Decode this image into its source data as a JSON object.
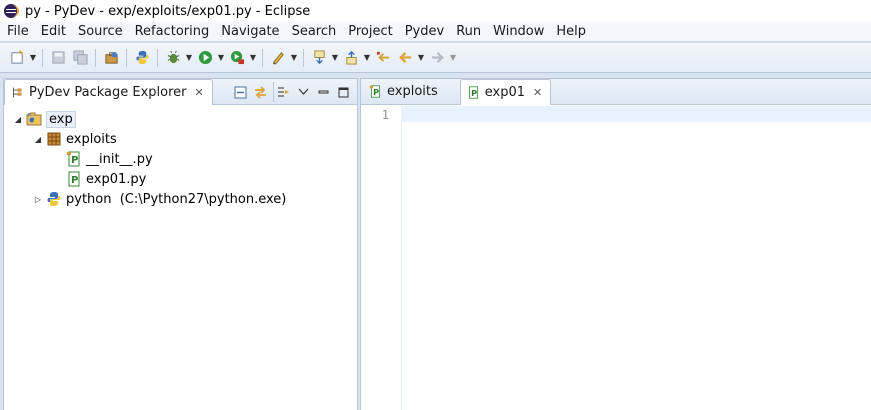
{
  "window": {
    "title": "py - PyDev - exp/exploits/exp01.py - Eclipse"
  },
  "menu": [
    "File",
    "Edit",
    "Source",
    "Refactoring",
    "Navigate",
    "Search",
    "Project",
    "Pydev",
    "Run",
    "Window",
    "Help"
  ],
  "explorer": {
    "tab_label": "PyDev Package Explorer",
    "tree": {
      "root": "exp",
      "package": "exploits",
      "file1": "__init__.py",
      "file2": "exp01.py",
      "interpreter": "python  (C:\\Python27\\python.exe)"
    }
  },
  "editor": {
    "tabs": [
      {
        "label": "exploits"
      },
      {
        "label": "exp01"
      }
    ],
    "line_number": "1"
  },
  "colors": {
    "accent": "#3a70b8",
    "selection": "#e8eef7",
    "current_line": "#e8f2fe"
  }
}
